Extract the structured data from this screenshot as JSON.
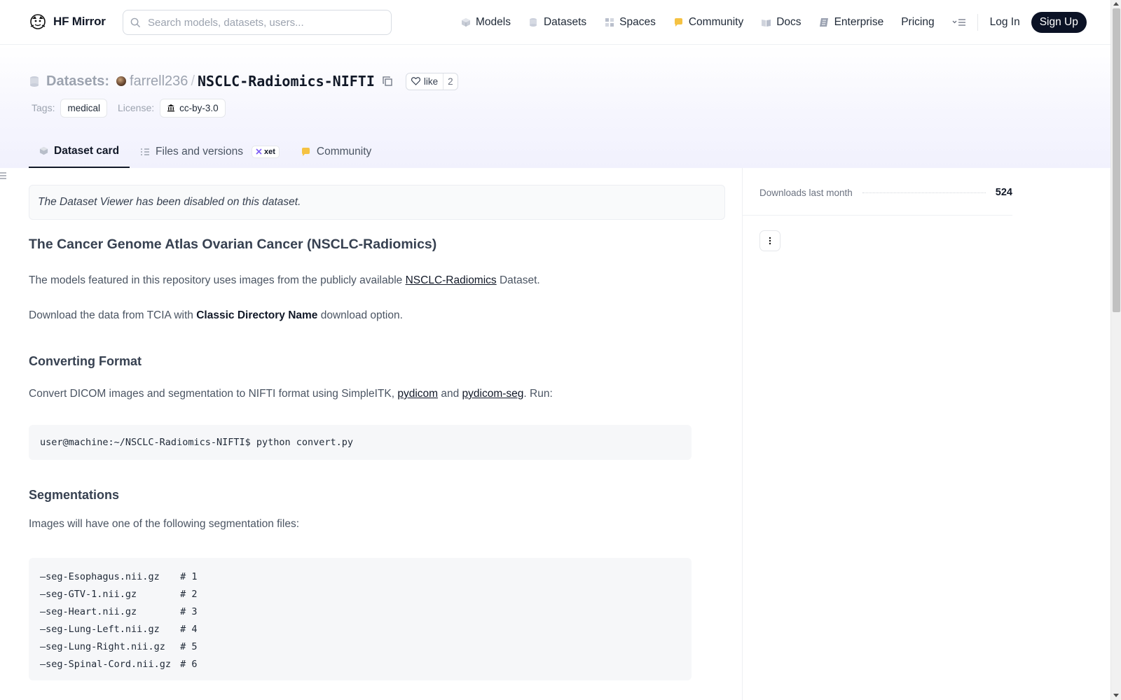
{
  "nav": {
    "brand": "HF Mirror",
    "search_placeholder": "Search models, datasets, users...",
    "links": [
      {
        "label": "Models",
        "icon": "models-cube-icon"
      },
      {
        "label": "Datasets",
        "icon": "datasets-db-icon"
      },
      {
        "label": "Spaces",
        "icon": "spaces-grid-icon"
      },
      {
        "label": "Community",
        "icon": "community-bubble-icon"
      },
      {
        "label": "Docs",
        "icon": "docs-book-icon"
      },
      {
        "label": "Enterprise",
        "icon": "enterprise-icon"
      },
      {
        "label": "Pricing",
        "icon": ""
      }
    ],
    "login": "Log In",
    "signup": "Sign Up"
  },
  "repo": {
    "type_label": "Datasets:",
    "owner": "farrell236",
    "separator": "/",
    "name": "NSCLC-Radiomics-NIFTI",
    "like_label": "like",
    "like_count": "2",
    "tags_label": "Tags:",
    "tags": [
      "medical"
    ],
    "license_label": "License:",
    "license": "cc-by-3.0"
  },
  "tabs": [
    {
      "label": "Dataset card",
      "active": true
    },
    {
      "label": "Files and versions",
      "badge": "xet"
    },
    {
      "label": "Community"
    }
  ],
  "content": {
    "notice": "The Dataset Viewer has been disabled on this dataset.",
    "heading": "The Cancer Genome Atlas Ovarian Cancer (NSCLC-Radiomics)",
    "p1_before": "The models featured in this repository uses images from the publicly available ",
    "p1_link": "NSCLC-Radiomics",
    "p1_after": " Dataset.",
    "p2_before": "Download the data from TCIA with ",
    "p2_bold": "Classic Directory Name",
    "p2_after": " download option.",
    "h2_convert": "Converting Format",
    "p3_before": "Convert DICOM images and segmentation to NIFTI format using SimpleITK, ",
    "p3_link1": "pydicom",
    "p3_mid": " and ",
    "p3_link2": "pydicom-seg",
    "p3_after": ". Run:",
    "command": "user@machine:~/NSCLC-Radiomics-NIFTI$ python convert.py",
    "h2_seg": "Segmentations",
    "p4": "Images will have one of the following segmentation files:",
    "seg_files": [
      {
        "name": "seg-Esophagus.nii.gz",
        "label": "# 1"
      },
      {
        "name": "seg-GTV-1.nii.gz",
        "label": "# 2"
      },
      {
        "name": "seg-Heart.nii.gz",
        "label": "# 3"
      },
      {
        "name": "seg-Lung-Left.nii.gz",
        "label": "# 4"
      },
      {
        "name": "seg-Lung-Right.nii.gz",
        "label": "# 5"
      },
      {
        "name": "seg-Spinal-Cord.nii.gz",
        "label": "# 6"
      }
    ],
    "seg_bullet": "—"
  },
  "sidebar": {
    "downloads_label": "Downloads last month",
    "downloads_value": "524"
  },
  "colors": {
    "signup_bg": "#0b1225",
    "header_gradient_end": "#f1f1fd",
    "community_icon": "#f5c242"
  }
}
